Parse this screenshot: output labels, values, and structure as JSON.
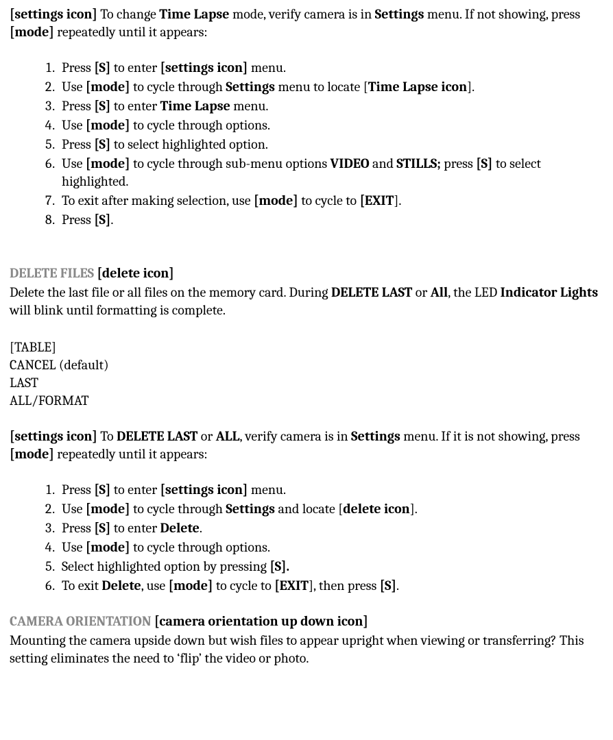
{
  "intro": {
    "pre": "[settings icon]",
    "t1": " To change ",
    "b1": "Time Lapse",
    "t2": " mode, verify camera is in ",
    "b2": "Settings",
    "t3": " menu. If not showing, press ",
    "b3": "[mode]",
    "t4": " repeatedly until it appears:"
  },
  "steps1": {
    "s1a": "Press ",
    "s1b": "[S]",
    "s1c": " to enter ",
    "s1d": "[settings icon]",
    "s1e": " menu.",
    "s2a": "Use ",
    "s2b": "[mode]",
    "s2c": " to cycle through ",
    "s2d": "Settings",
    "s2e": " menu to locate [",
    "s2f": "Time Lapse icon",
    "s2g": "].",
    "s3a": "Press ",
    "s3b": "[S]",
    "s3c": " to enter ",
    "s3d": "Time Lapse",
    "s3e": " menu.",
    "s4a": "Use ",
    "s4b": "[mode]",
    "s4c": " to cycle through options.",
    "s5a": "Press ",
    "s5b": "[S]",
    "s5c": " to select highlighted option.",
    "s6a": "Use ",
    "s6b": "[mode]",
    "s6c": " to cycle through sub-menu options ",
    "s6d": "VIDEO",
    "s6e": " and ",
    "s6f": "STILLS;",
    "s6g": " press ",
    "s6h": "[S]",
    "s6i": " to select highlighted.",
    "s7a": "To exit after making selection, use ",
    "s7b": "[mode]",
    "s7c": " to cycle to ",
    "s7d": "[EXIT",
    "s7e": "].",
    "s8a": "Press ",
    "s8b": "[S]",
    "s8c": "."
  },
  "delete": {
    "title": "DELETE FILES ",
    "icon": "[delete icon]",
    "d1": "Delete the last file or all files on the memory card. During ",
    "d2": "DELETE LAST",
    "d3": " or ",
    "d4": "All",
    "d5": ", the LED ",
    "d6": "Indicator Lights",
    "d7": " will blink until formatting is complete."
  },
  "table": {
    "label": "[TABLE]",
    "r1": "CANCEL  (default)",
    "r2": "LAST",
    "r3": "ALL/FORMAT"
  },
  "delintro": {
    "pre": "[settings icon]",
    "t1": " To ",
    "b1": "DELETE LAST",
    "t2": " or ",
    "b2": "ALL",
    "t3": ", verify camera is in ",
    "b3": "Settings",
    "t4": " menu. If it is not showing, press ",
    "b4": "[mode]",
    "t5": " repeatedly until it appears:"
  },
  "steps2": {
    "s1a": "Press ",
    "s1b": "[S]",
    "s1c": " to enter ",
    "s1d": "[settings icon]",
    "s1e": " menu.",
    "s2a": "Use ",
    "s2b": "[mode]",
    "s2c": " to cycle through ",
    "s2d": "Settings",
    "s2e": " and locate [",
    "s2f": "delete icon",
    "s2g": "].",
    "s3a": "Press ",
    "s3b": "[S]",
    "s3c": " to enter ",
    "s3d": "Delete",
    "s3e": ".",
    "s4a": "Use ",
    "s4b": "[mode]",
    "s4c": " to cycle through options.",
    "s5a": "Select highlighted option by pressing ",
    "s5b": "[S].",
    "s6a": "To exit ",
    "s6b": "Delete",
    "s6c": ", use ",
    "s6d": "[mode]",
    "s6e": " to cycle to ",
    "s6f": "[EXIT",
    "s6g": "], then press ",
    "s6h": "[S]",
    "s6i": "."
  },
  "orient": {
    "title": "CAMERA ORIENTATION ",
    "icon": "[camera orientation up down icon]",
    "body": "Mounting the camera upside down but wish files to appear upright when viewing or transferring?  This setting eliminates the need to ‘flip’ the video or photo."
  }
}
